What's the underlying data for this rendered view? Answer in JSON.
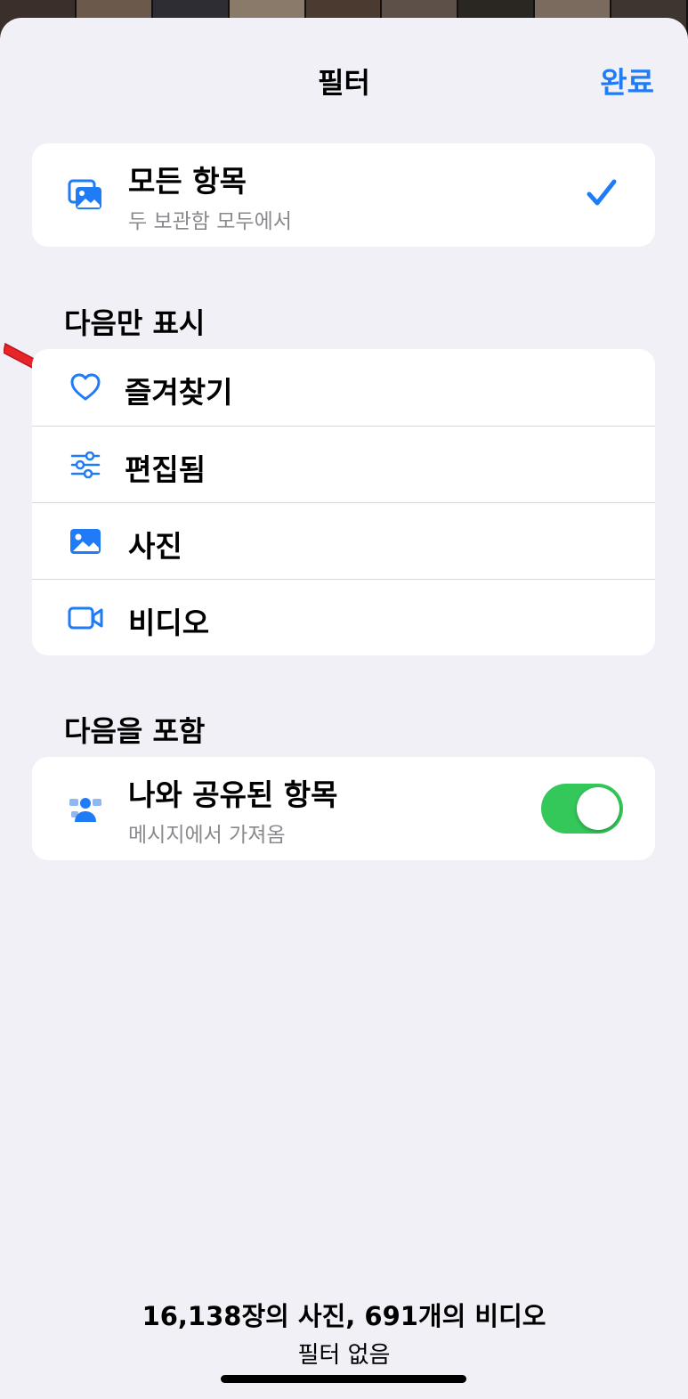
{
  "header": {
    "title": "필터",
    "done_label": "완료"
  },
  "all_items": {
    "title": "모든 항목",
    "subtitle": "두 보관함 모두에서",
    "selected": true
  },
  "show_only": {
    "title": "다음만 표시",
    "items": [
      {
        "label": "즐겨찾기",
        "icon": "heart-icon"
      },
      {
        "label": "편집됨",
        "icon": "sliders-icon"
      },
      {
        "label": "사진",
        "icon": "photo-icon"
      },
      {
        "label": "비디오",
        "icon": "video-icon"
      }
    ]
  },
  "include": {
    "title": "다음을 포함",
    "item": {
      "title": "나와 공유된 항목",
      "subtitle": "메시지에서 가져옴",
      "enabled": true,
      "icon": "shared-with-you-icon"
    }
  },
  "footer": {
    "count_text": "16,138장의 사진, 691개의 비디오",
    "filter_text": "필터 없음"
  },
  "colors": {
    "accent": "#1f7bf6",
    "toggle_on": "#34c759",
    "background": "#f1f0f6",
    "annotation_arrow": "#e8232a"
  }
}
